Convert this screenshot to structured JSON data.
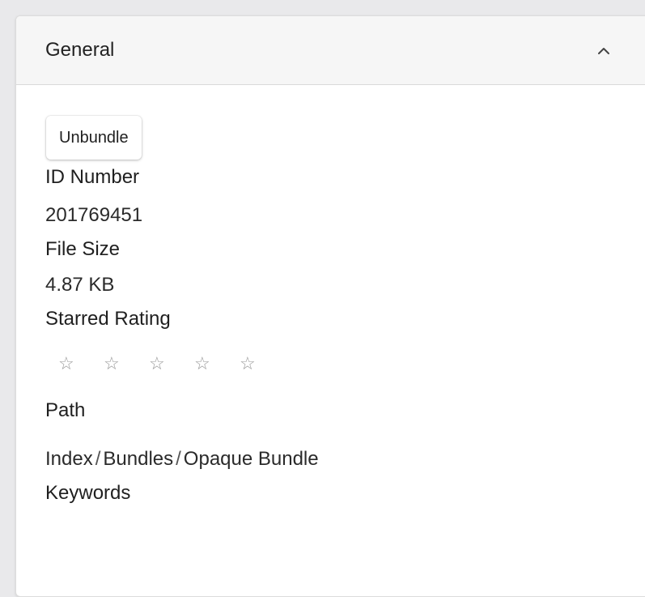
{
  "section": {
    "title": "General",
    "collapse_icon": "chevron-up-icon"
  },
  "actions": {
    "unbundle_label": "Unbundle"
  },
  "fields": {
    "id_number": {
      "label": "ID Number",
      "value": "201769451"
    },
    "file_size": {
      "label": "File Size",
      "value": "4.87 KB"
    },
    "starred_rating": {
      "label": "Starred Rating",
      "value": 0,
      "max": 5,
      "star_glyph": "☆"
    },
    "path": {
      "label": "Path",
      "segments": [
        "Index",
        "Bundles",
        "Opaque Bundle"
      ],
      "separator": "/"
    },
    "keywords": {
      "label": "Keywords"
    }
  }
}
